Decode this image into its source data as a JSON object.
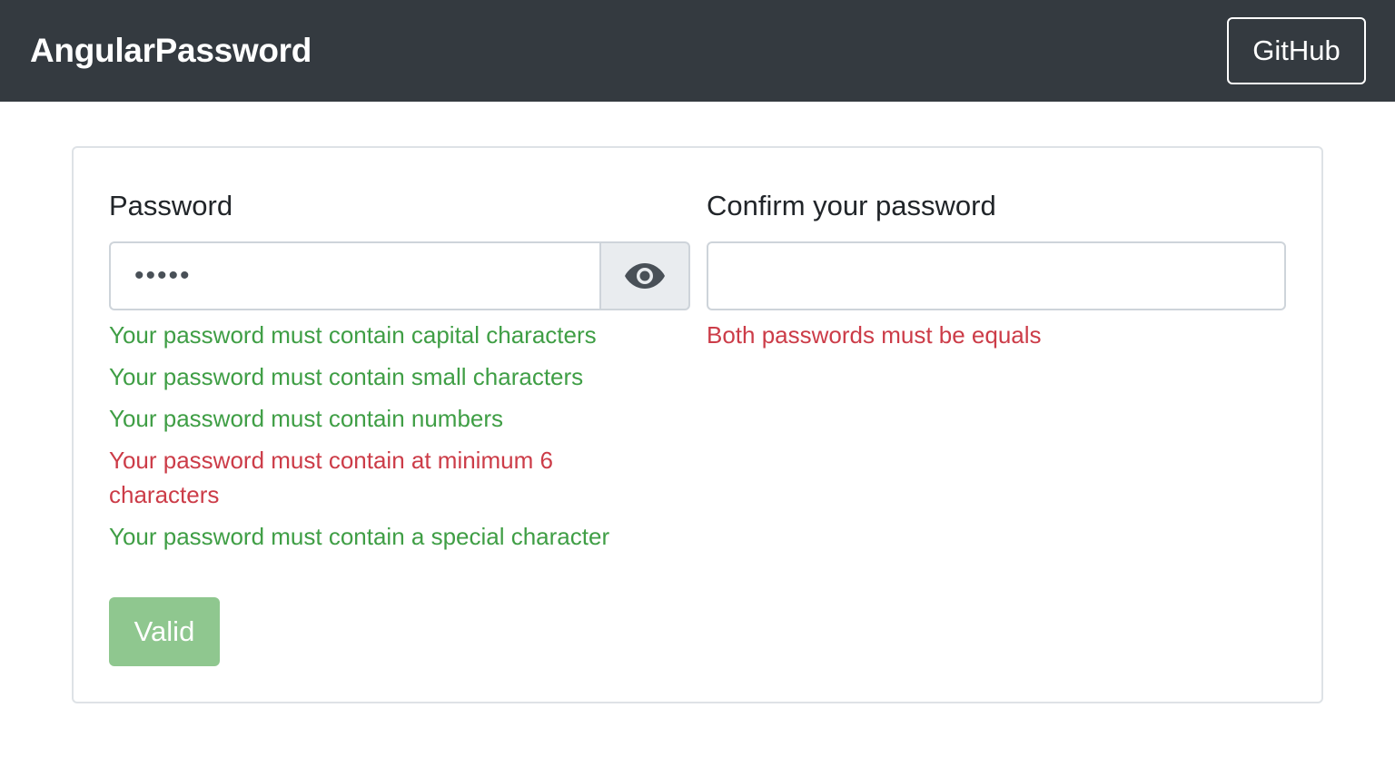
{
  "navbar": {
    "brand": "AngularPassword",
    "github_label": "GitHub"
  },
  "form": {
    "password": {
      "label": "Password",
      "value": "•••••",
      "toggle_icon": "eye-icon"
    },
    "confirm": {
      "label": "Confirm your password",
      "value": ""
    },
    "password_messages": [
      {
        "text": "Your password must contain capital characters",
        "status": "valid"
      },
      {
        "text": "Your password must contain small characters",
        "status": "valid"
      },
      {
        "text": "Your password must contain numbers",
        "status": "valid"
      },
      {
        "text": "Your password must contain at minimum 6 characters",
        "status": "invalid"
      },
      {
        "text": "Your password must contain a special character",
        "status": "valid"
      }
    ],
    "confirm_messages": [
      {
        "text": "Both passwords must be equals",
        "status": "invalid"
      }
    ],
    "submit_label": "Valid"
  },
  "colors": {
    "navbar_bg": "#343a40",
    "valid_text": "#3f9e45",
    "invalid_text": "#cc3c48",
    "submit_bg": "#8fc78f"
  }
}
